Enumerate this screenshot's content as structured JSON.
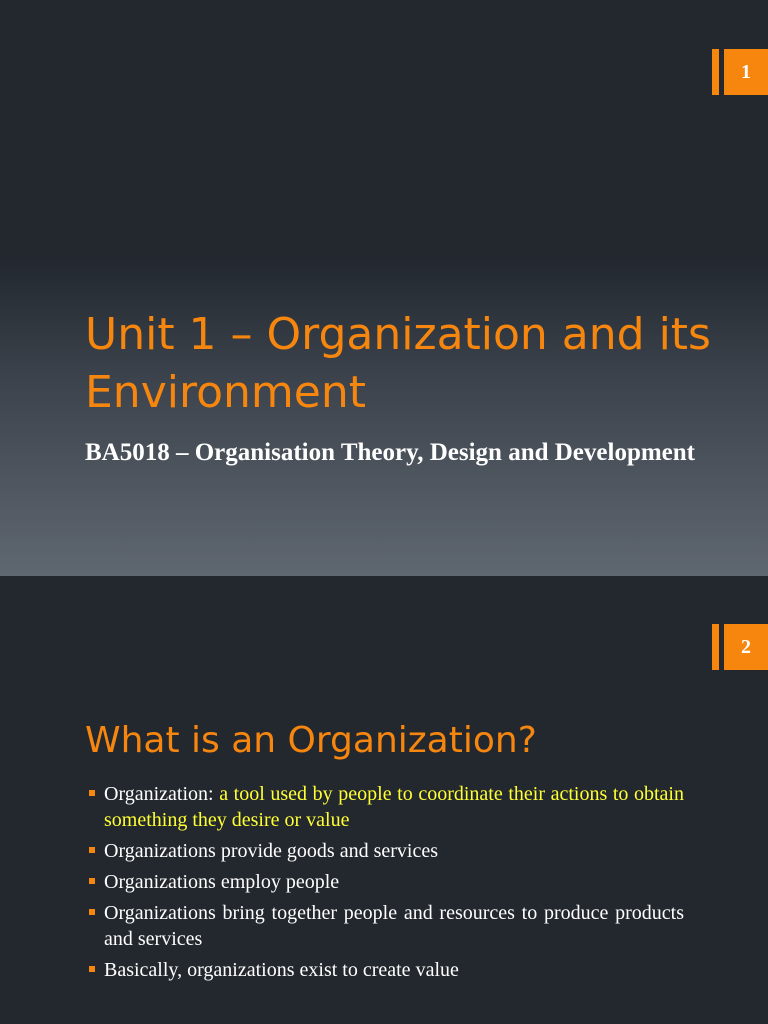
{
  "slide1": {
    "number": "1",
    "title": "Unit 1 – Organization and its Environment",
    "subtitle": "BA5018 – Organisation Theory, Design and Development"
  },
  "slide2": {
    "number": "2",
    "title": "What is an Organization?",
    "bullets": [
      {
        "lead": "Organization: ",
        "highlight": "a tool used by people to coordinate their actions to obtain something they desire or value"
      },
      {
        "lead": "Organizations provide goods and services",
        "highlight": ""
      },
      {
        "lead": "Organizations employ people",
        "highlight": ""
      },
      {
        "lead": "Organizations bring together people and resources to produce products and services",
        "highlight": ""
      },
      {
        "lead": "Basically, organizations exist to create value",
        "highlight": ""
      }
    ]
  },
  "colors": {
    "accent": "#f7860f",
    "background": "#23282f",
    "highlight_text": "#ffff33"
  }
}
